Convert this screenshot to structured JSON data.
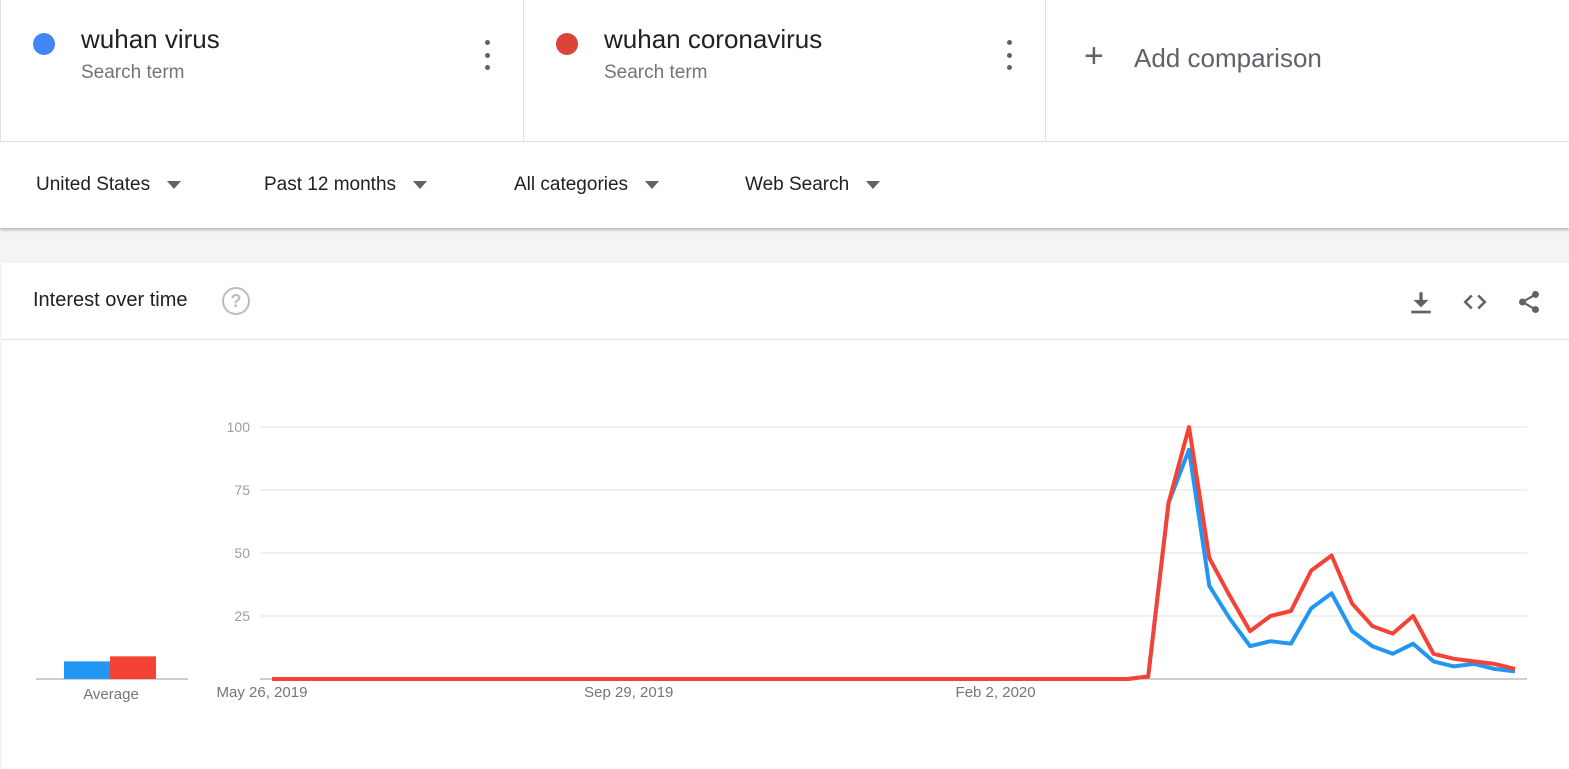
{
  "terms": [
    {
      "name": "wuhan virus",
      "sub": "Search term",
      "color": "#4285f4"
    },
    {
      "name": "wuhan coronavirus",
      "sub": "Search term",
      "color": "#db4437"
    }
  ],
  "add_comparison": {
    "icon": "plus-icon",
    "label": "Add comparison"
  },
  "filters": {
    "region": "United States",
    "time": "Past 12 months",
    "category": "All categories",
    "search_type": "Web Search"
  },
  "card": {
    "title": "Interest over time",
    "help_icon": "help-circle-icon",
    "actions": [
      "download-icon",
      "embed-code-icon",
      "share-icon"
    ]
  },
  "chart_data": {
    "type": "line",
    "title": "",
    "xlabel": "",
    "ylabel": "",
    "ylim": [
      0,
      100
    ],
    "yticks": [
      25,
      50,
      75,
      100
    ],
    "grid": true,
    "x_tick_labels": [
      "May 26, 2019",
      "Sep 29, 2019",
      "Feb 2, 2020"
    ],
    "x_start": "2019-05-26",
    "x_step_days": 7,
    "average_label": "Average",
    "averages": [
      7,
      9
    ],
    "series": [
      {
        "name": "wuhan virus",
        "color": "#2196f3",
        "values": [
          0,
          0,
          0,
          0,
          0,
          0,
          0,
          0,
          0,
          0,
          0,
          0,
          0,
          0,
          0,
          0,
          0,
          0,
          0,
          0,
          0,
          0,
          0,
          0,
          0,
          0,
          0,
          0,
          0,
          0,
          0,
          0,
          0,
          0,
          0,
          0,
          0,
          0,
          0,
          0,
          0,
          0,
          0,
          1,
          70,
          91,
          37,
          24,
          13,
          15,
          14,
          28,
          34,
          19,
          13,
          10,
          14,
          7,
          5,
          6,
          4,
          3
        ]
      },
      {
        "name": "wuhan coronavirus",
        "color": "#f44336",
        "values": [
          0,
          0,
          0,
          0,
          0,
          0,
          0,
          0,
          0,
          0,
          0,
          0,
          0,
          0,
          0,
          0,
          0,
          0,
          0,
          0,
          0,
          0,
          0,
          0,
          0,
          0,
          0,
          0,
          0,
          0,
          0,
          0,
          0,
          0,
          0,
          0,
          0,
          0,
          0,
          0,
          0,
          0,
          0,
          1,
          70,
          100,
          48,
          33,
          19,
          25,
          27,
          43,
          49,
          30,
          21,
          18,
          25,
          10,
          8,
          7,
          6,
          4
        ]
      }
    ]
  }
}
